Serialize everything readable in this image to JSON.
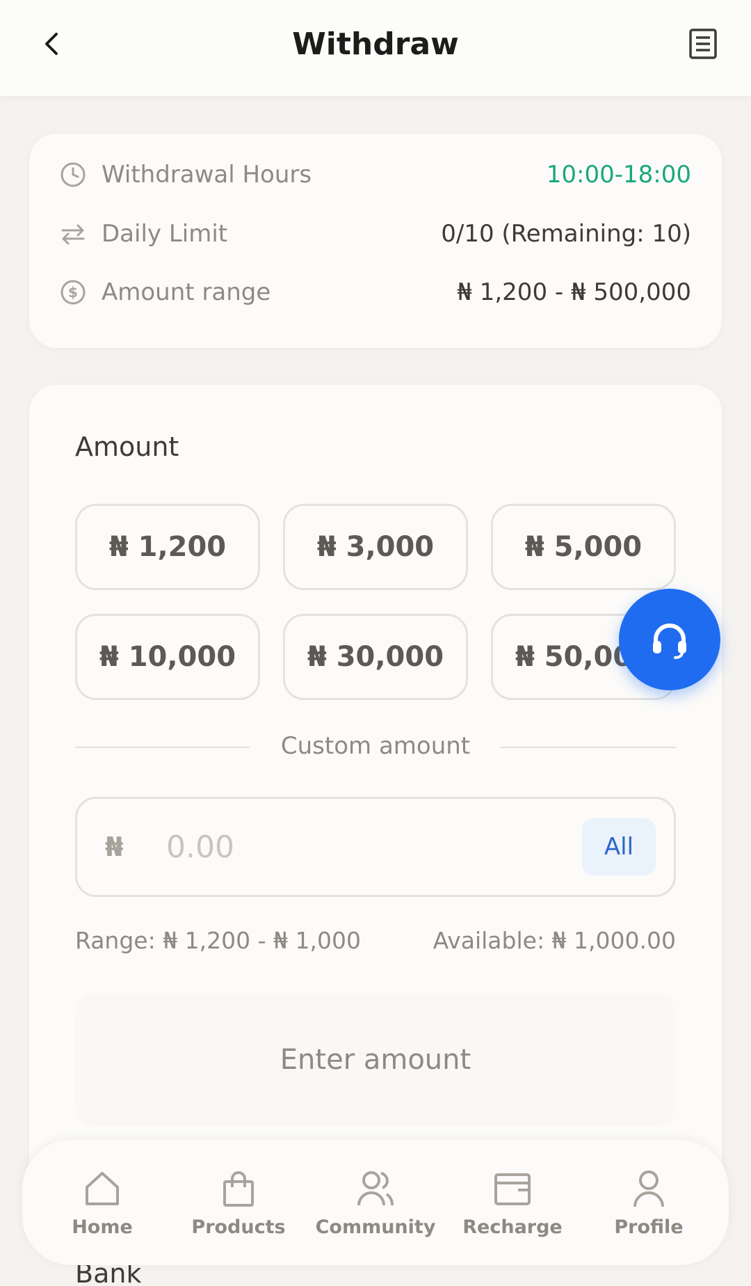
{
  "header": {
    "title": "Withdraw",
    "back_icon": "chevron-left-icon",
    "record_icon": "document-list-icon"
  },
  "info": {
    "hours_label": "Withdrawal Hours",
    "hours_value": "10:00-18:00",
    "limit_label": "Daily Limit",
    "limit_value": "0/10 (Remaining: 10)",
    "range_label": "Amount range",
    "range_value": "₦ 1,200 - ₦ 500,000",
    "accent_color": "#1aa77f"
  },
  "amount": {
    "label": "Amount",
    "presets": [
      "₦ 1,200",
      "₦ 3,000",
      "₦ 5,000",
      "₦ 10,000",
      "₦ 30,000",
      "₦ 50,000"
    ],
    "custom_label": "Custom amount",
    "currency_symbol": "₦",
    "placeholder": "0.00",
    "all_label": "All",
    "range_text": "Range: ₦ 1,200 - ₦ 1,000",
    "available_text": "Available: ₦ 1,000.00",
    "submit_label": "Enter amount"
  },
  "bank": {
    "label": "Bank"
  },
  "support": {
    "icon": "headset-icon",
    "color": "#1f6cf0"
  },
  "nav": {
    "items": [
      {
        "label": "Home",
        "icon": "home-icon"
      },
      {
        "label": "Products",
        "icon": "shopping-bag-icon"
      },
      {
        "label": "Community",
        "icon": "users-icon"
      },
      {
        "label": "Recharge",
        "icon": "wallet-icon"
      },
      {
        "label": "Profile",
        "icon": "user-icon"
      }
    ]
  }
}
